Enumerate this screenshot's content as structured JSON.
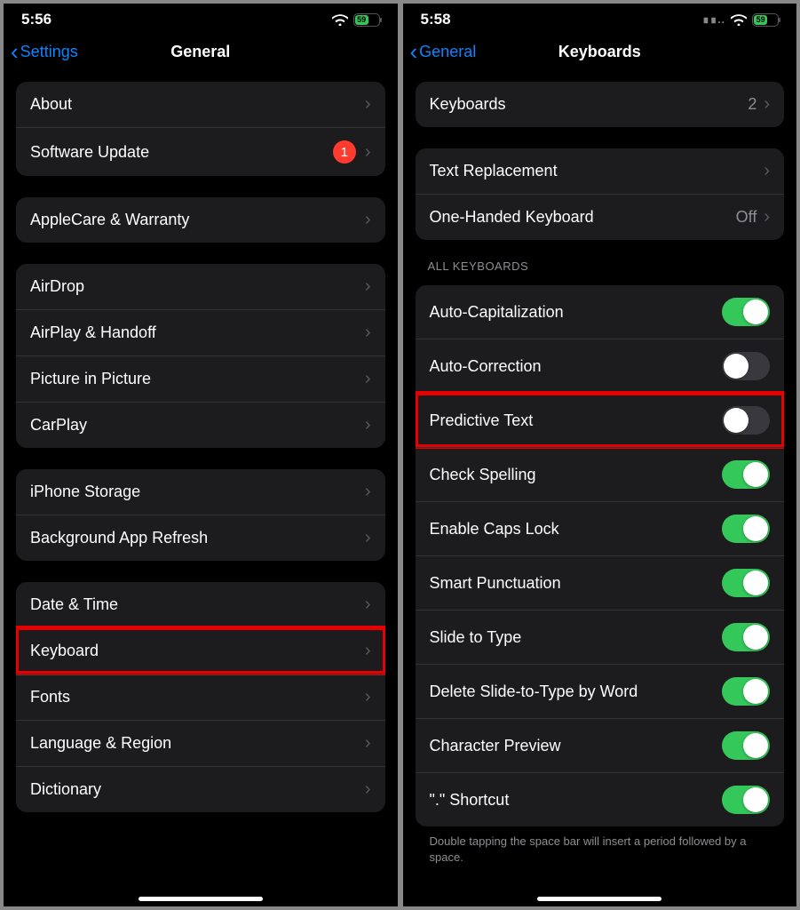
{
  "left": {
    "status": {
      "time": "5:56",
      "battery": "59",
      "wifi": true
    },
    "nav": {
      "back": "Settings",
      "title": "General"
    },
    "groups": [
      {
        "rows": [
          {
            "label": "About",
            "chevron": true
          },
          {
            "label": "Software Update",
            "badge": "1",
            "chevron": true
          }
        ]
      },
      {
        "rows": [
          {
            "label": "AppleCare & Warranty",
            "chevron": true
          }
        ]
      },
      {
        "rows": [
          {
            "label": "AirDrop",
            "chevron": true
          },
          {
            "label": "AirPlay & Handoff",
            "chevron": true
          },
          {
            "label": "Picture in Picture",
            "chevron": true
          },
          {
            "label": "CarPlay",
            "chevron": true
          }
        ]
      },
      {
        "rows": [
          {
            "label": "iPhone Storage",
            "chevron": true
          },
          {
            "label": "Background App Refresh",
            "chevron": true
          }
        ]
      },
      {
        "rows": [
          {
            "label": "Date & Time",
            "chevron": true
          },
          {
            "label": "Keyboard",
            "chevron": true,
            "highlight": true
          },
          {
            "label": "Fonts",
            "chevron": true
          },
          {
            "label": "Language & Region",
            "chevron": true
          },
          {
            "label": "Dictionary",
            "chevron": true
          }
        ]
      }
    ]
  },
  "right": {
    "status": {
      "time": "5:58",
      "battery": "59",
      "wifi": true,
      "dots": true
    },
    "nav": {
      "back": "General",
      "title": "Keyboards"
    },
    "groups": [
      {
        "rows": [
          {
            "label": "Keyboards",
            "value": "2",
            "chevron": true
          }
        ]
      },
      {
        "rows": [
          {
            "label": "Text Replacement",
            "chevron": true
          },
          {
            "label": "One-Handed Keyboard",
            "value": "Off",
            "chevron": true
          }
        ]
      },
      {
        "header": "ALL KEYBOARDS",
        "rows": [
          {
            "label": "Auto-Capitalization",
            "toggle": true
          },
          {
            "label": "Auto-Correction",
            "toggle": false
          },
          {
            "label": "Predictive Text",
            "toggle": false,
            "highlight": true
          },
          {
            "label": "Check Spelling",
            "toggle": true
          },
          {
            "label": "Enable Caps Lock",
            "toggle": true
          },
          {
            "label": "Smart Punctuation",
            "toggle": true
          },
          {
            "label": "Slide to Type",
            "toggle": true
          },
          {
            "label": "Delete Slide-to-Type by Word",
            "toggle": true
          },
          {
            "label": "Character Preview",
            "toggle": true
          },
          {
            "label": "\".\" Shortcut",
            "toggle": true
          }
        ],
        "footer": "Double tapping the space bar will insert a period followed by a space."
      }
    ]
  }
}
